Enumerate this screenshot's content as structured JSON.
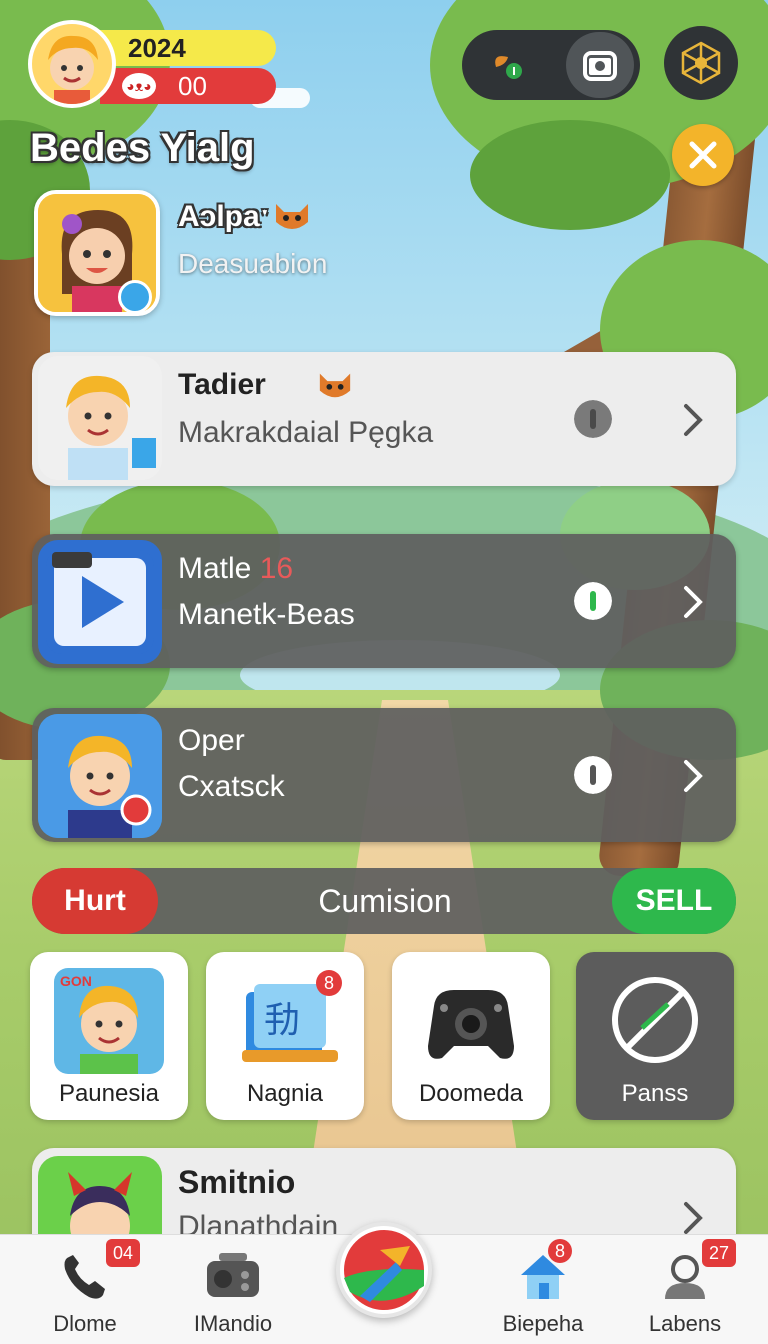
{
  "header": {
    "year": "2024",
    "score": "00",
    "title": "Bedes Yialg"
  },
  "profile": {
    "name": "Aɔlpaˑ",
    "subtitle": "Deasuabion"
  },
  "list": [
    {
      "title": "Tadier",
      "subtitle": "Makrakdaial Pęgka",
      "style": "light"
    },
    {
      "title": "Matle",
      "title_badge": "16",
      "subtitle": "Manetk-Beas",
      "style": "dark"
    },
    {
      "title": "Oper",
      "subtitle": "Cxatsck",
      "style": "dark"
    }
  ],
  "action_bar": {
    "left": "Hurt",
    "center": "Cumision",
    "right": "SELL"
  },
  "tiles": [
    {
      "label": "Paunesia",
      "corner": "GON"
    },
    {
      "label": "Nagnia",
      "badge": "8",
      "icon_text": "劧"
    },
    {
      "label": "Doomeda"
    },
    {
      "label": "Panss"
    }
  ],
  "bottom_card": {
    "title": "Smitnio",
    "subtitle": "Dlanathdain"
  },
  "nav": [
    {
      "label": "Dlome",
      "badge": "04",
      "icon": "phone-icon"
    },
    {
      "label": "IMandio",
      "icon": "radio-icon"
    },
    {
      "label": "Biepeha",
      "badge": "8",
      "icon": "house-icon"
    },
    {
      "label": "Labens",
      "badge": "27",
      "icon": "person-icon"
    }
  ],
  "colors": {
    "accent_red": "#e23b3b",
    "accent_green": "#2eb84c",
    "accent_yellow": "#f3b42a",
    "card_dark": "#5f5f5f",
    "card_light": "#ededed"
  }
}
